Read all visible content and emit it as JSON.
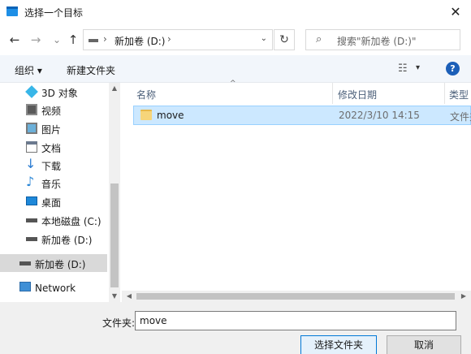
{
  "window": {
    "title": "选择一个目标",
    "close_glyph": "✕"
  },
  "nav": {
    "back_glyph": "←",
    "forward_glyph": "→",
    "history_glyph": "⌄",
    "up_glyph": "↑",
    "address_sep": "›",
    "address_text": "新加卷 (D:)",
    "address_sep_end": "›",
    "address_drop": "⌄",
    "refresh_glyph": "↻",
    "search_glyph": "⌕",
    "search_placeholder": "搜索\"新加卷 (D:)\""
  },
  "toolbar": {
    "organize_label": "组织 ▾",
    "new_folder_label": "新建文件夹",
    "view_glyph": "☷",
    "view_drop": "▾",
    "help_glyph": "?"
  },
  "sidebar": {
    "items": [
      {
        "label": "3D 对象",
        "icon": "cube-3d-icon"
      },
      {
        "label": "视频",
        "icon": "video-icon"
      },
      {
        "label": "图片",
        "icon": "picture-icon"
      },
      {
        "label": "文档",
        "icon": "document-icon"
      },
      {
        "label": "下载",
        "icon": "download-icon"
      },
      {
        "label": "音乐",
        "icon": "music-icon"
      },
      {
        "label": "桌面",
        "icon": "desktop-icon"
      },
      {
        "label": "本地磁盘 (C:)",
        "icon": "drive-icon"
      },
      {
        "label": "新加卷 (D:)",
        "icon": "drive-icon"
      },
      {
        "label": "新加卷 (D:)",
        "icon": "drive-icon"
      },
      {
        "label": "Network",
        "icon": "network-icon"
      }
    ],
    "scroll_up": "▲",
    "scroll_down": "▼"
  },
  "columns": {
    "name": "名称",
    "date": "修改日期",
    "type": "类型",
    "sort_glyph": "^"
  },
  "files": [
    {
      "name": "move",
      "date": "2022/3/10 14:15",
      "type": "文件夹"
    }
  ],
  "hscroll": {
    "left": "◀",
    "right": "▶"
  },
  "footer": {
    "filename_label": "文件夹:",
    "filename_value": "move",
    "select_label": "选择文件夹",
    "cancel_label": "取消"
  },
  "colors": {
    "accent": "#0078d7",
    "selection": "#cce8ff",
    "folder": "#f6d57a",
    "help": "#1c5fb8"
  }
}
